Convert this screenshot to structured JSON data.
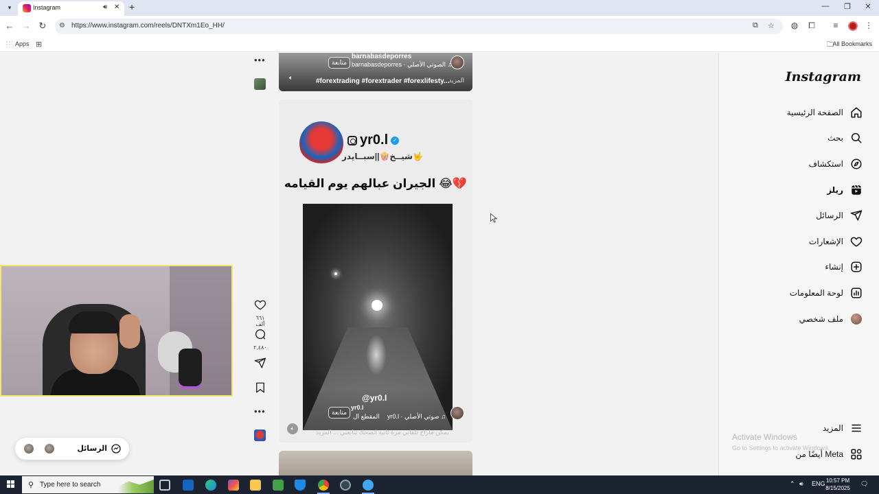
{
  "browser": {
    "tab_title": "Instagram",
    "url": "https://www.instagram.com/reels/DNTXm1Eo_HH/",
    "bookmarks_apps": "Apps",
    "bookmarks_all": "All Bookmarks"
  },
  "sidebar": {
    "logo": "Instagram",
    "items": [
      {
        "label": "الصفحة الرئيسية",
        "icon": "home-icon"
      },
      {
        "label": "بحث",
        "icon": "search-icon"
      },
      {
        "label": "استكشاف",
        "icon": "explore-icon"
      },
      {
        "label": "ريلز",
        "icon": "reels-icon"
      },
      {
        "label": "الرسائل",
        "icon": "messages-icon"
      },
      {
        "label": "الإشعارات",
        "icon": "heart-icon"
      },
      {
        "label": "إنشاء",
        "icon": "create-icon"
      },
      {
        "label": "لوحة المعلومات",
        "icon": "dashboard-icon"
      },
      {
        "label": "ملف شخصي",
        "icon": "profile-avatar"
      }
    ],
    "more": "المزيد",
    "also_from_meta": "أيضًا من Meta"
  },
  "windows_watermark": {
    "title": "Activate Windows",
    "subtitle": "Go to Settings to activate Windows."
  },
  "reel_top": {
    "username": "barnabasdeporres",
    "follow": "متابعة",
    "audio": "barnabasdeporres · الصوتي الأصلي ♫",
    "hashtags": "#forextrading #forextrader #forexlifesty...",
    "more": "المزيد"
  },
  "reel_main": {
    "handle": "yr0.l",
    "display_name": "شيــخ🍿||سبــايدر🤟",
    "headline": "الجيران عبالهم يوم القيامه 😂💔",
    "video_watermark": "@yr0.l",
    "username": "yr0.l",
    "follow": "متابعة",
    "clip_label": "المقطع ال",
    "audio": "yr0.l · صوتي الأصلي ♫",
    "caption": "يمكن ماراح تلقاني مرة ثانية اتصحك تتابعني ... المزيد"
  },
  "actions": {
    "likes": "٦٦١ ألف",
    "comments": "٢,٤٨٠"
  },
  "messages_pill": {
    "label": "الرسائل"
  },
  "taskbar": {
    "search_placeholder": "Type here to search",
    "language": "ENG",
    "time": "10:57 PM",
    "date": "8/15/2025"
  }
}
